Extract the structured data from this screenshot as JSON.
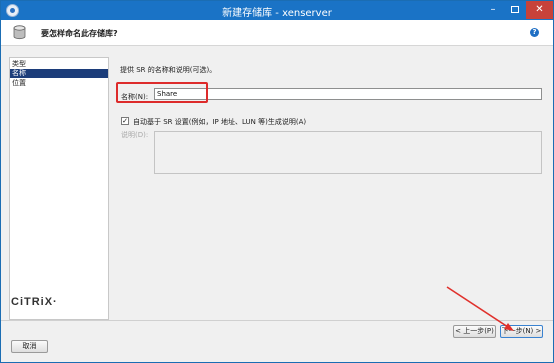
{
  "window": {
    "title": "新建存储库 - xenserver",
    "minimize_glyph": "–",
    "close_glyph": "✕"
  },
  "header": {
    "title": "要怎样命名此存储库?",
    "help_glyph": "?"
  },
  "nav": {
    "items": [
      {
        "label": "类型",
        "selected": false
      },
      {
        "label": "名称",
        "selected": true
      },
      {
        "label": "位置",
        "selected": false
      }
    ],
    "brand": "CiTRiX·"
  },
  "form": {
    "description": "提供 SR 的名称和说明(可选)。",
    "name_label": "名称(N):",
    "name_value": "Share",
    "auto_checked": true,
    "check_glyph": "✓",
    "auto_label": "自动基于 SR 设置(例如，IP 地址、LUN 等)生成说明(A)",
    "desc_label": "说明(D):"
  },
  "buttons": {
    "prev": "< 上一步(P)",
    "next": "下一步(N) >",
    "cancel": "取消"
  },
  "annotations": {
    "highlight_color": "#dd2b2b"
  }
}
